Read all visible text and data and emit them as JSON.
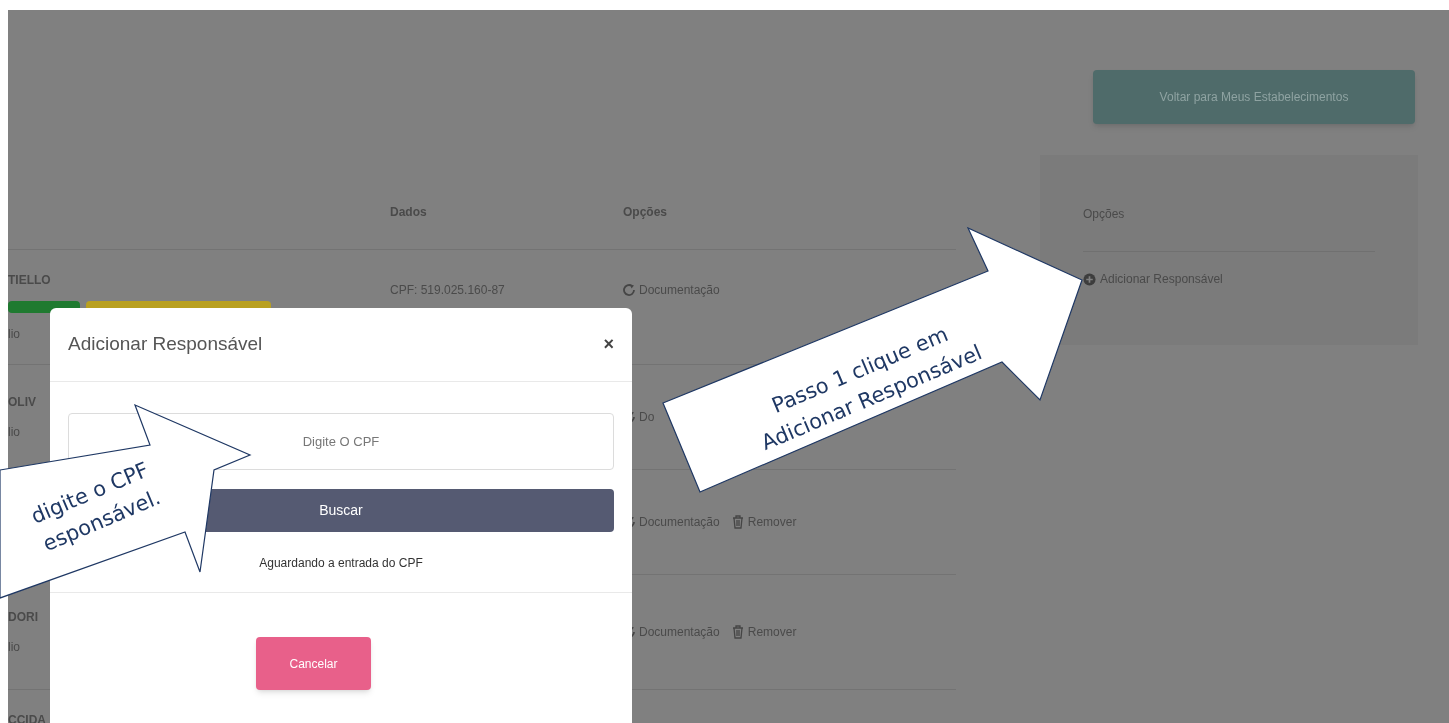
{
  "header": {
    "back_button": "Voltar para Meus Estabelecimentos"
  },
  "table": {
    "columns": [
      "Dados",
      "Opções"
    ],
    "rows": [
      {
        "name": "TIELLO",
        "sub": "lio",
        "badges": [
          {
            "color": "#1f7a30"
          },
          {
            "color": "#b9a020"
          }
        ],
        "cpf": "CPF: 519.025.160-87",
        "actions": [
          {
            "kind": "doc",
            "label": "Documentação"
          }
        ]
      },
      {
        "name": "OLIV",
        "sub": "lio",
        "actions": [
          {
            "kind": "doc",
            "label": "Do"
          }
        ]
      },
      {
        "actions": [
          {
            "kind": "doc",
            "label": "Documentação"
          },
          {
            "kind": "remove",
            "label": "Remover"
          }
        ]
      },
      {
        "name": "DORI",
        "sub": "lio",
        "actions": [
          {
            "kind": "doc",
            "label": "Documentação"
          },
          {
            "kind": "remove",
            "label": "Remover"
          }
        ]
      },
      {
        "name": "CCIDA"
      }
    ]
  },
  "side_panel": {
    "title": "Opções",
    "items": [
      "Adicionar Responsável"
    ]
  },
  "modal": {
    "title": "Adicionar Responsável",
    "close": "×",
    "input": {
      "placeholder": "Digite O CPF"
    },
    "search_button": "Buscar",
    "status": "Aguardando a entrada do CPF",
    "cancel_button": "Cancelar"
  },
  "callouts": [
    {
      "lines": [
        "Passo 1 clique em",
        "Adicionar Responsável"
      ]
    },
    {
      "lines": [
        "digite o CPF",
        "esponsável."
      ]
    }
  ]
}
